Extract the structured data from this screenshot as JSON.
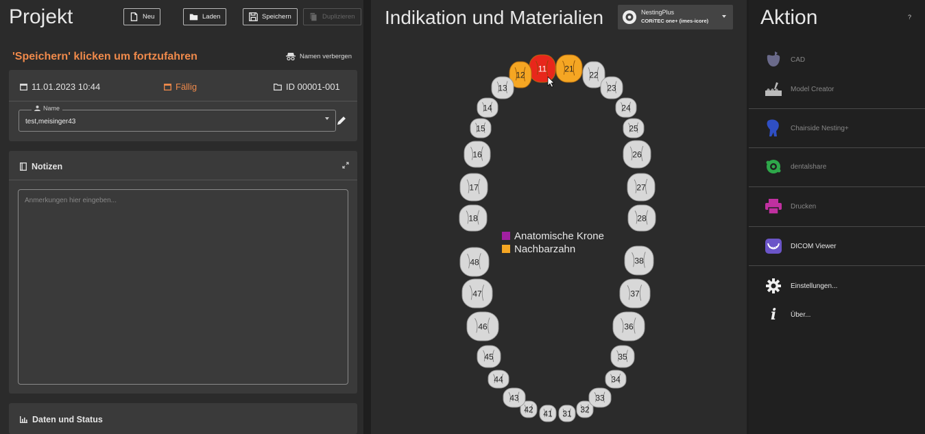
{
  "left": {
    "title": "Projekt",
    "toolbar": {
      "new": "Neu",
      "load": "Laden",
      "save": "Speichern",
      "duplicate": "Duplizieren"
    },
    "prompt": "'Speichern' klicken um fortzufahren",
    "hide_names": "Namen verbergen",
    "info": {
      "date": "11.01.2023 10:44",
      "due": "Fällig",
      "id": "ID 00001-001"
    },
    "name": {
      "legend": "Name",
      "value": "test,meisinger43"
    },
    "notes": {
      "title": "Notizen",
      "placeholder": "Anmerkungen hier eingeben..."
    },
    "status": {
      "title": "Daten und Status"
    }
  },
  "mid": {
    "title": "Indikation und Materialien",
    "nesting": {
      "line1": "NestingPlus",
      "line2": "CORiTEC one+ (imes-icore)"
    },
    "legend": [
      {
        "label": "Anatomische Krone",
        "color": "#a020a0"
      },
      {
        "label": "Nachbarzahn",
        "color": "#f5a623"
      }
    ],
    "teeth_upper_right": [
      "11",
      "12",
      "13",
      "14",
      "15",
      "16",
      "17",
      "18"
    ],
    "teeth_upper_left": [
      "21",
      "22",
      "23",
      "24",
      "25",
      "26",
      "27",
      "28"
    ],
    "teeth_lower_left": [
      "31",
      "32",
      "33",
      "34",
      "35",
      "36",
      "37",
      "38"
    ],
    "teeth_lower_right": [
      "41",
      "42",
      "43",
      "44",
      "45",
      "46",
      "47",
      "48"
    ],
    "tooth_states": {
      "11": "selected",
      "12": "neighbor",
      "21": "neighbor"
    },
    "tooth_colors": {
      "default": "#d8d8d8",
      "selected": "#e8271b",
      "neighbor": "#f5a623"
    }
  },
  "right": {
    "title": "Aktion",
    "help": "?",
    "actions": [
      {
        "label": "CAD",
        "icon": "cad-icon"
      },
      {
        "label": "Model Creator",
        "icon": "model-creator-icon"
      },
      {
        "label": "Chairside Nesting+",
        "icon": "chairside-nesting-icon"
      },
      {
        "label": "dentalshare",
        "icon": "dentalshare-icon"
      },
      {
        "label": "Drucken",
        "icon": "printer-icon"
      },
      {
        "label": "DICOM Viewer",
        "icon": "dicom-viewer-icon"
      },
      {
        "label": "Einstellungen...",
        "icon": "gear-icon"
      },
      {
        "label": "Über...",
        "icon": "info-icon"
      }
    ]
  }
}
